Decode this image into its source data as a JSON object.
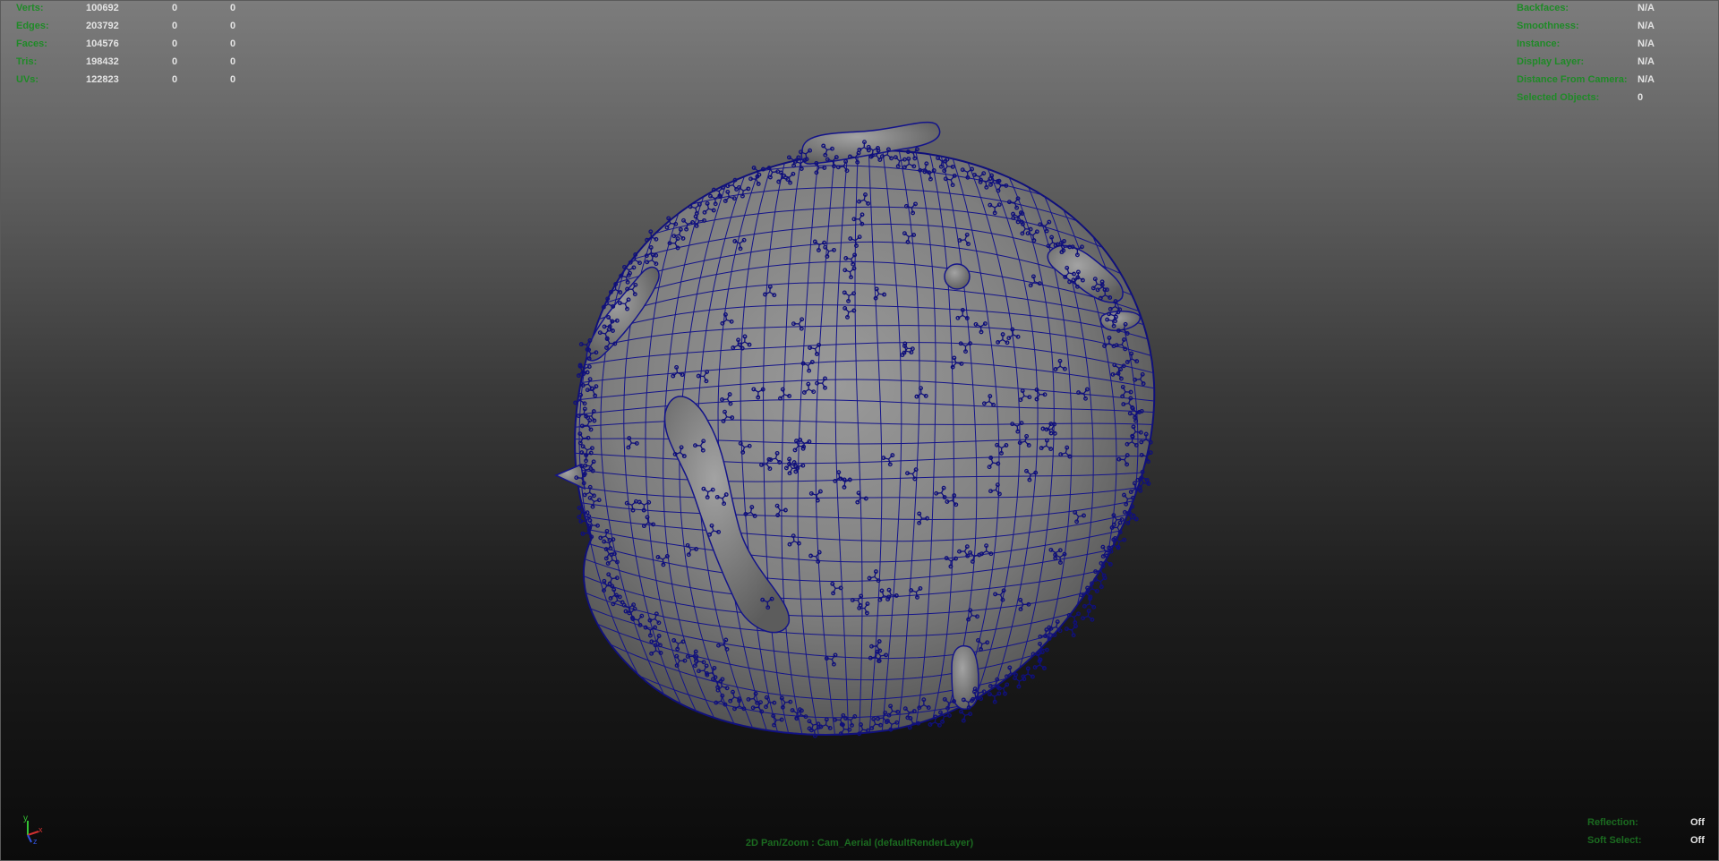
{
  "viewport": {
    "camera_label": "2D Pan/Zoom : Cam_Aerial (defaultRenderLayer)"
  },
  "poly_count": {
    "rows": [
      {
        "label": "Verts:",
        "total": "100692",
        "selected": "0",
        "ratio": "0"
      },
      {
        "label": "Edges:",
        "total": "203792",
        "selected": "0",
        "ratio": "0"
      },
      {
        "label": "Faces:",
        "total": "104576",
        "selected": "0",
        "ratio": "0"
      },
      {
        "label": "Tris:",
        "total": "198432",
        "selected": "0",
        "ratio": "0"
      },
      {
        "label": "UVs:",
        "total": "122823",
        "selected": "0",
        "ratio": "0"
      }
    ]
  },
  "object_info": {
    "rows": [
      {
        "label": "Backfaces:",
        "value": "N/A"
      },
      {
        "label": "Smoothness:",
        "value": "N/A"
      },
      {
        "label": "Instance:",
        "value": "N/A"
      },
      {
        "label": "Display Layer:",
        "value": "N/A"
      },
      {
        "label": "Distance From Camera:",
        "value": "N/A"
      },
      {
        "label": "Selected Objects:",
        "value": "0"
      }
    ]
  },
  "selection_status": {
    "rows": [
      {
        "label": "Reflection:",
        "value": "Off"
      },
      {
        "label": "Soft Select:",
        "value": "Off"
      }
    ]
  },
  "axis": {
    "y": "y",
    "x": "x",
    "z": "z"
  },
  "colors": {
    "hud_label": "#1f8a27",
    "hud_value": "#e4e4e4",
    "wireframe": "#10107a",
    "mesh_surface": "#888888"
  }
}
